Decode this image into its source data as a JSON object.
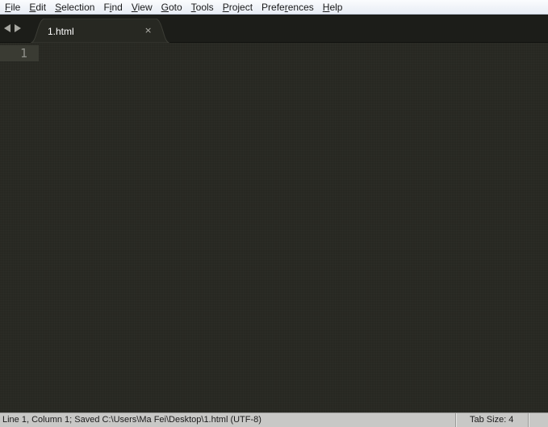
{
  "menu": [
    {
      "mnemonic": "F",
      "rest": "ile"
    },
    {
      "mnemonic": "E",
      "rest": "dit"
    },
    {
      "mnemonic": "S",
      "rest": "election"
    },
    {
      "pre": "F",
      "mnemonic": "i",
      "rest": "nd"
    },
    {
      "mnemonic": "V",
      "rest": "iew"
    },
    {
      "mnemonic": "G",
      "rest": "oto"
    },
    {
      "mnemonic": "T",
      "rest": "ools"
    },
    {
      "mnemonic": "P",
      "rest": "roject"
    },
    {
      "pre": "Prefe",
      "mnemonic": "r",
      "rest": "ences"
    },
    {
      "mnemonic": "H",
      "rest": "elp"
    }
  ],
  "tabbar": {
    "back_icon": "triangle-left-icon",
    "forward_icon": "triangle-right-icon",
    "tabs": [
      {
        "label": "1.html",
        "close_glyph": "×",
        "active": true
      }
    ]
  },
  "editor": {
    "line_numbers": [
      "1"
    ],
    "content": ""
  },
  "status": {
    "text": "Line 1, Column 1; Saved C:\\Users\\Ma Fei\\Desktop\\1.html (UTF-8)",
    "tab_size": "Tab Size: 4"
  },
  "colors": {
    "editor_bg": "#272822",
    "tabbar_bg": "#1c1d19",
    "active_tab_bg": "#272822",
    "gutter_current_line": "#3a3b33",
    "line_number": "#8f908a",
    "statusbar_bg": "#c8c8c6",
    "menubar_bg": "#eef2f8"
  }
}
